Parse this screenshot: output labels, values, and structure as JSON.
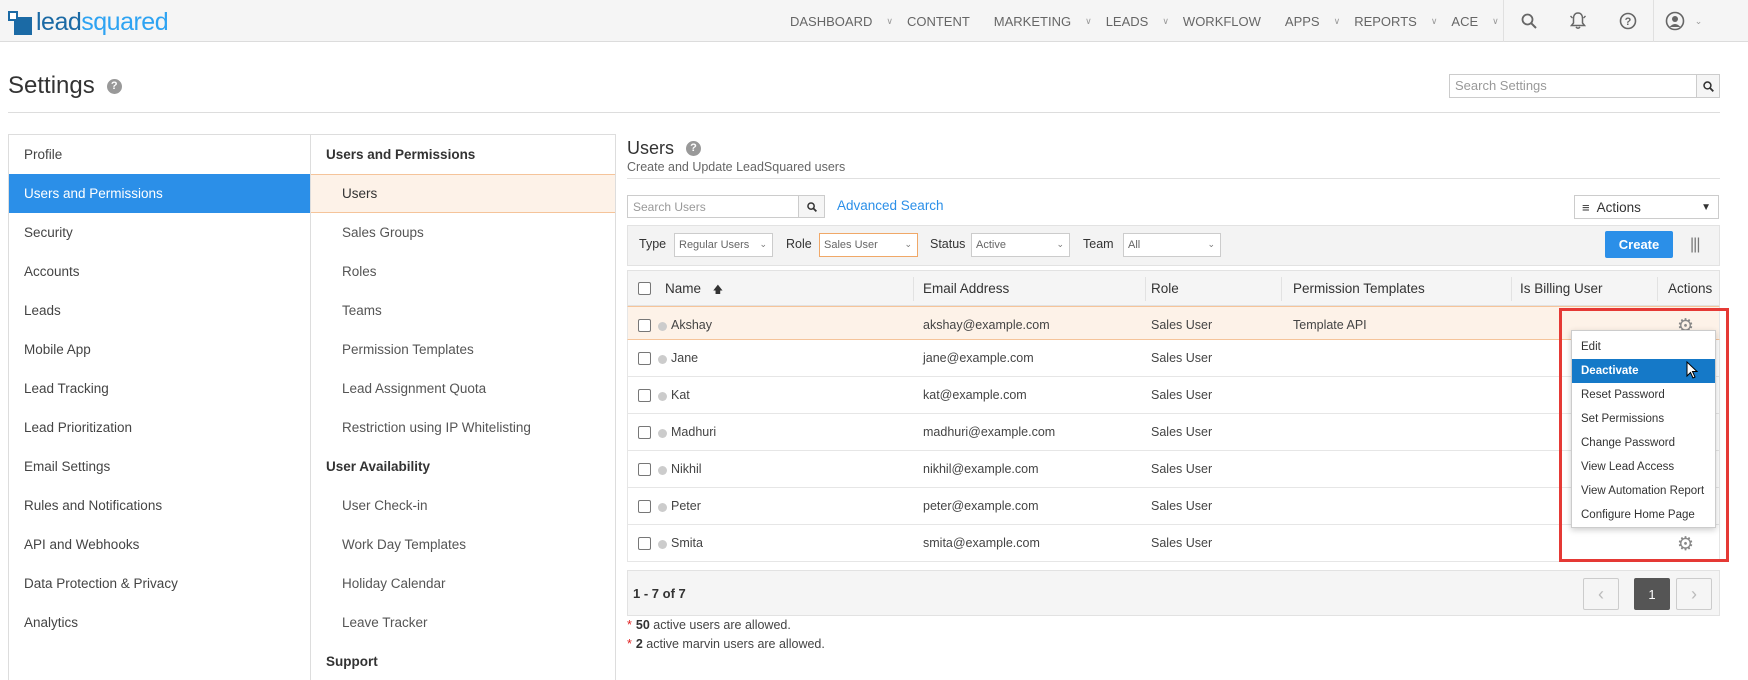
{
  "brand": {
    "part1": "lead",
    "part2": "squared"
  },
  "nav": {
    "items": [
      {
        "label": "DASHBOARD",
        "caret": true
      },
      {
        "label": "CONTENT",
        "caret": false
      },
      {
        "label": "MARKETING",
        "caret": true
      },
      {
        "label": "LEADS",
        "caret": true
      },
      {
        "label": "WORKFLOW",
        "caret": false
      },
      {
        "label": "APPS",
        "caret": true
      },
      {
        "label": "REPORTS",
        "caret": true
      },
      {
        "label": "ACE",
        "caret": true
      }
    ]
  },
  "page": {
    "title": "Settings",
    "search_placeholder": "Search Settings"
  },
  "left_menu": [
    "Profile",
    "Users and Permissions",
    "Security",
    "Accounts",
    "Leads",
    "Mobile App",
    "Lead Tracking",
    "Lead Prioritization",
    "Email Settings",
    "Rules and Notifications",
    "API and Webhooks",
    "Data Protection & Privacy",
    "Analytics"
  ],
  "left_active_index": 1,
  "mid_menu": {
    "section1": "Users and Permissions",
    "items1": [
      "Users",
      "Sales Groups",
      "Roles",
      "Teams",
      "Permission Templates",
      "Lead Assignment Quota",
      "Restriction using IP Whitelisting"
    ],
    "section2": "User Availability",
    "items2": [
      "User Check-in",
      "Work Day Templates",
      "Holiday Calendar",
      "Leave Tracker"
    ],
    "section3": "Support"
  },
  "content": {
    "title": "Users",
    "subtitle": "Create and Update LeadSquared users",
    "search_placeholder": "Search Users",
    "advanced_search": "Advanced Search",
    "actions_label": "Actions",
    "create_label": "Create"
  },
  "filters": {
    "type_label": "Type",
    "type_value": "Regular Users",
    "role_label": "Role",
    "role_value": "Sales User",
    "status_label": "Status",
    "status_value": "Active",
    "team_label": "Team",
    "team_value": "All"
  },
  "table": {
    "headers": {
      "name": "Name",
      "email": "Email Address",
      "role": "Role",
      "perm": "Permission Templates",
      "billing": "Is Billing User",
      "actions": "Actions"
    },
    "rows": [
      {
        "name": "Akshay",
        "email": "akshay@example.com",
        "role": "Sales User",
        "perm": "Template API"
      },
      {
        "name": "Jane",
        "email": "jane@example.com",
        "role": "Sales User",
        "perm": ""
      },
      {
        "name": "Kat",
        "email": "kat@example.com",
        "role": "Sales User",
        "perm": ""
      },
      {
        "name": "Madhuri",
        "email": "madhuri@example.com",
        "role": "Sales User",
        "perm": ""
      },
      {
        "name": "Nikhil",
        "email": "nikhil@example.com",
        "role": "Sales User",
        "perm": ""
      },
      {
        "name": "Peter",
        "email": "peter@example.com",
        "role": "Sales User",
        "perm": ""
      },
      {
        "name": "Smita",
        "email": "smita@example.com",
        "role": "Sales User",
        "perm": ""
      }
    ]
  },
  "pager": {
    "summary": "1 - 7 of 7",
    "current_page": "1"
  },
  "notes": [
    {
      "count": "50",
      "text": " active users are allowed."
    },
    {
      "count": "2",
      "text": " active marvin users are allowed."
    }
  ],
  "dropdown": {
    "items": [
      "Edit",
      "Deactivate",
      "Reset Password",
      "Set Permissions",
      "Change Password",
      "View Lead Access",
      "View Automation Report",
      "Configure Home Page"
    ],
    "selected_index": 1
  },
  "colors": {
    "accent": "#2b8fe8",
    "highlight_bg": "#fdf2e8",
    "menu_selected": "#1579c8",
    "annotation_red": "#e53935"
  }
}
